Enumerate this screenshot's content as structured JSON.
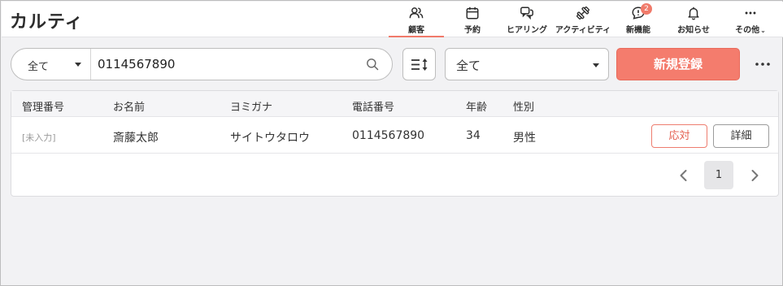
{
  "app": {
    "title": "カルティ"
  },
  "nav": [
    {
      "label": "顧客",
      "icon": "users-icon",
      "active": true
    },
    {
      "label": "予約",
      "icon": "calendar-icon"
    },
    {
      "label": "ヒアリング",
      "icon": "chat-bubbles-icon"
    },
    {
      "label": "アクティビティ",
      "icon": "dumbbell-icon"
    },
    {
      "label": "新機能",
      "icon": "announcement-icon",
      "badge": "2"
    },
    {
      "label": "お知らせ",
      "icon": "bell-icon"
    },
    {
      "label": "その他",
      "icon": "more-dots-icon"
    }
  ],
  "search": {
    "scope": "全て",
    "value": "0114567890"
  },
  "filter": {
    "selected": "全て"
  },
  "toolbar": {
    "register_label": "新規登録"
  },
  "table": {
    "columns": [
      "管理番号",
      "お名前",
      "ヨミガナ",
      "電話番号",
      "年齢",
      "性別"
    ],
    "rows": [
      {
        "id": "[未入力]",
        "name": "斎藤太郎",
        "kana": "サイトウタロウ",
        "phone": "0114567890",
        "age": "34",
        "gender": "男性",
        "respond_label": "応対",
        "detail_label": "詳細"
      }
    ]
  },
  "pagination": {
    "current": "1"
  },
  "colors": {
    "accent": "#f47c6d",
    "accent_text": "#e45f4f",
    "background": "#f2f2f4"
  }
}
